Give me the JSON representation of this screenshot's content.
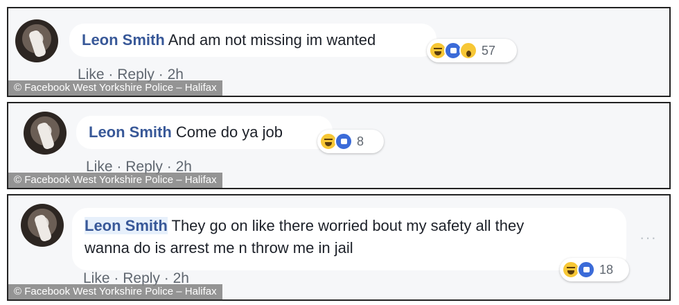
{
  "comments": [
    {
      "author": "Leon Smith",
      "text": "And am not missing im wanted",
      "reactions": [
        "haha-icon",
        "like-icon",
        "wow-icon"
      ],
      "reaction_count": "57",
      "actions": {
        "like": "Like",
        "reply": "Reply",
        "time": "2h",
        "sep": "·"
      },
      "caption": "© Facebook West Yorkshire Police – Halifax"
    },
    {
      "author": "Leon Smith",
      "text": "Come do ya job",
      "reactions": [
        "haha-icon",
        "like-icon"
      ],
      "reaction_count": "8",
      "actions": {
        "like": "Like",
        "reply": "Reply",
        "time": "2h",
        "sep": "·"
      },
      "caption": "© Facebook West Yorkshire Police – Halifax"
    },
    {
      "author": "Leon Smith",
      "text_line1": "They go on like there worried bout my safety all they",
      "text_line2": "wanna do is arrest me n throw me in jail",
      "reactions": [
        "haha-icon",
        "like-icon"
      ],
      "reaction_count": "18",
      "more": "···",
      "actions": {
        "like": "Like",
        "reply": "Reply",
        "time": "2h",
        "sep": "·"
      },
      "caption": "© Facebook West Yorkshire Police – Halifax"
    }
  ],
  "colors": {
    "name": "#385898",
    "bubble": "#ffffff",
    "panel": "#f6f7f9",
    "like_blue": "#3b6bd8",
    "haha_yellow": "#f7c736"
  }
}
